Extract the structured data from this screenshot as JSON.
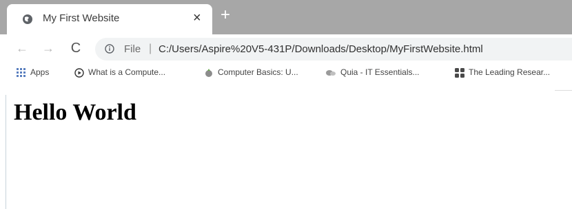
{
  "browser": {
    "tab": {
      "title": "My First Website",
      "close_glyph": "×"
    },
    "new_tab_glyph": "+",
    "nav": {
      "back_glyph": "←",
      "forward_glyph": "→",
      "reload_glyph": "C"
    },
    "address_bar": {
      "scheme_label": "File",
      "separator": "|",
      "url": "C:/Users/Aspire%20V5-431P/Downloads/Desktop/MyFirstWebsite.html"
    },
    "bookmarks": [
      {
        "label": "Apps",
        "icon": "apps-grid-icon"
      },
      {
        "label": "What is a Compute...",
        "icon": "play-circle-icon"
      },
      {
        "label": "Computer Basics: U...",
        "icon": "gcf-icon"
      },
      {
        "label": "Quia - IT Essentials...",
        "icon": "quia-icon"
      },
      {
        "label": "The Leading Resear...",
        "icon": "grid-dots-icon"
      }
    ]
  },
  "page": {
    "heading": "Hello World"
  },
  "colors": {
    "tabstrip": "#a7a7a7",
    "omnibox": "#f1f3f4"
  }
}
